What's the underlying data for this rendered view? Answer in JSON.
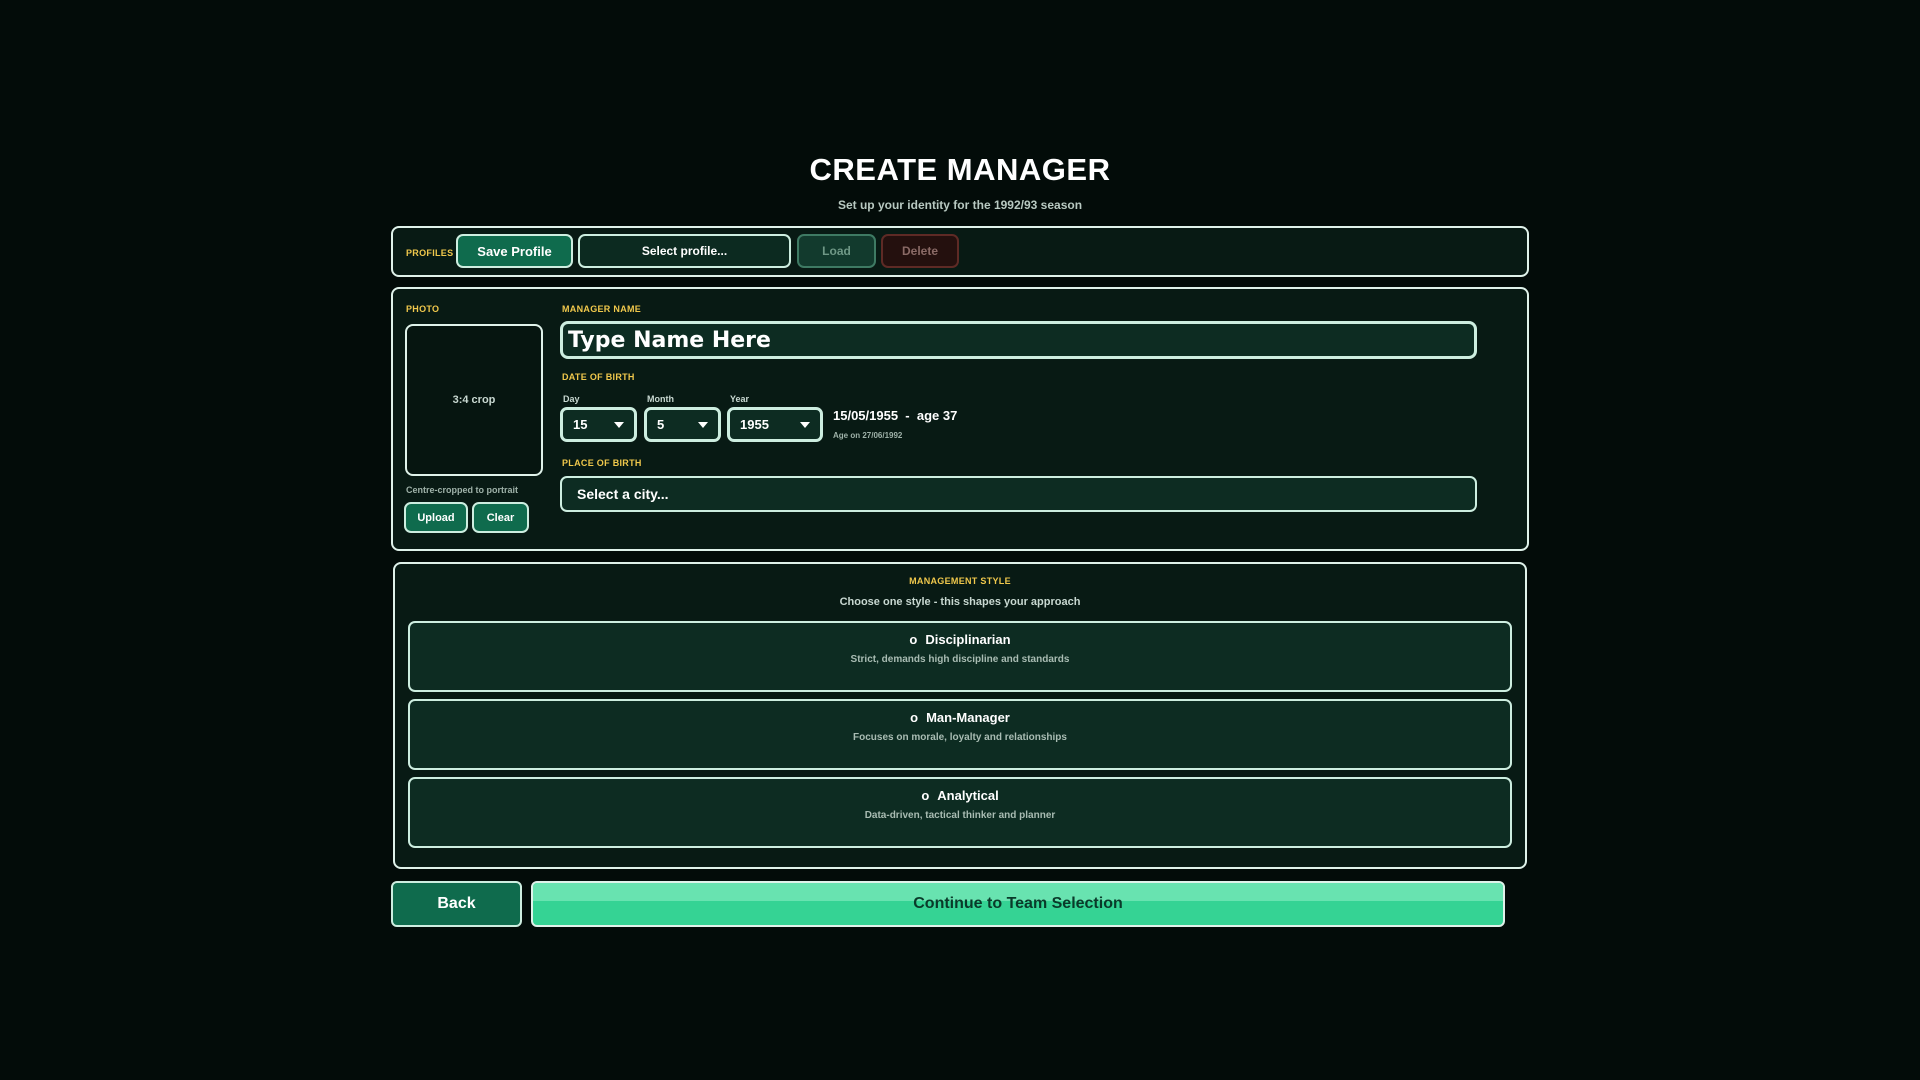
{
  "header": {
    "title": "CREATE MANAGER",
    "subtitle": "Set up your identity for the 1992/93 season"
  },
  "profiles": {
    "label": "PROFILES",
    "save_label": "Save Profile",
    "select_placeholder": "Select profile...",
    "load_label": "Load",
    "delete_label": "Delete"
  },
  "photo": {
    "label": "PHOTO",
    "placeholder": "3:4 crop",
    "hint": "Centre-cropped to portrait",
    "upload_label": "Upload",
    "clear_label": "Clear"
  },
  "manager_name": {
    "label": "MANAGER NAME",
    "placeholder": "Type Name Here",
    "value": ""
  },
  "date_of_birth": {
    "label": "DATE OF BIRTH",
    "day_label": "Day",
    "day_value": "15",
    "month_label": "Month",
    "month_value": "5",
    "year_label": "Year",
    "year_value": "1955",
    "summary": "15/05/1955  -  age 37",
    "age_note": "Age on 27/06/1992"
  },
  "place_of_birth": {
    "label": "PLACE OF BIRTH",
    "placeholder": "Select a city..."
  },
  "management_style": {
    "label": "MANAGEMENT STYLE",
    "instruction": "Choose one style - this shapes your approach",
    "options": [
      {
        "radio": "o",
        "name": "Disciplinarian",
        "description": "Strict, demands high discipline and standards"
      },
      {
        "radio": "o",
        "name": "Man-Manager",
        "description": "Focuses on morale, loyalty and relationships"
      },
      {
        "radio": "o",
        "name": "Analytical",
        "description": "Data-driven, tactical thinker and planner"
      }
    ]
  },
  "footer": {
    "back_label": "Back",
    "continue_label": "Continue to Team Selection"
  },
  "colors": {
    "background": "#030c09",
    "panel": "#081a14",
    "accent": "#0f6b4d",
    "label_gold": "#f0c84c",
    "continue_green": "#35d394"
  }
}
